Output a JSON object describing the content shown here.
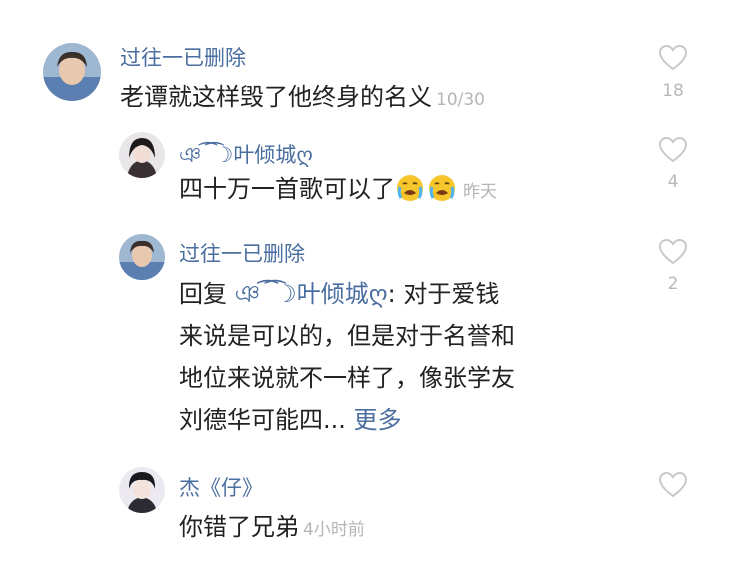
{
  "comments": [
    {
      "user": "过往一已删除",
      "text": "老谭就这样毁了他终身的名义",
      "meta": "10/30",
      "likes": "18"
    },
    {
      "user": "ঞ︎ ͡ ͡☽叶倾城ღ",
      "text": "四十万一首歌可以了",
      "emoji_names": [
        "crying-face-emoji",
        "crying-face-emoji"
      ],
      "meta": "昨天",
      "likes": "4"
    },
    {
      "user": "过往一已删除",
      "reply_prefix": "回复",
      "reply_to": "ঞ︎ ͡ ͡☽叶倾城ღ",
      "lines": [
        ": 对于爱钱",
        "来说是可以的，但是对于名誉和",
        "地位来说就不一样了，像张学友",
        "刘德华可能四..."
      ],
      "more_label": "更多",
      "likes": "2"
    },
    {
      "user": "杰《仔》",
      "text": "你错了兄弟",
      "meta": "4小时前",
      "likes": ""
    }
  ],
  "colors": {
    "username": "#4a6ea0",
    "text": "#222222",
    "meta": "#b5b5b5",
    "heart": "#c9c9c9"
  }
}
